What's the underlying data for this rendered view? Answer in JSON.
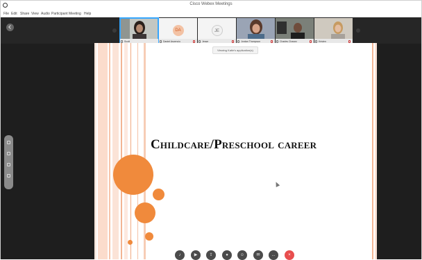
{
  "window": {
    "title": "Cisco Webex Meetings"
  },
  "menu": [
    "File",
    "Edit",
    "Share",
    "View",
    "Audio",
    "Participant",
    "Meeting",
    "Help"
  ],
  "participants": [
    {
      "name": "Scott",
      "type": "video",
      "active": true
    },
    {
      "name": "Daniel Ascencio",
      "type": "initials",
      "initials": "DA",
      "color": "#f3c2a4",
      "text_color": "#d05a22"
    },
    {
      "name": "Jesse",
      "type": "initials",
      "initials": "JE",
      "color": "#f1f1f1",
      "text_color": "#6e6e6e"
    },
    {
      "name": "Jordan Thompson",
      "type": "video"
    },
    {
      "name": "Charles Chavez",
      "type": "video"
    },
    {
      "name": "Kristen",
      "type": "video"
    }
  ],
  "share": {
    "viewing_label": "Viewing Katie's application(s)"
  },
  "slide": {
    "title": "Childcare/Preschool career",
    "accent_color": "#f08a3c"
  },
  "controls": [
    {
      "name": "mute",
      "icon": "microphone-icon"
    },
    {
      "name": "video",
      "icon": "camera-icon"
    },
    {
      "name": "share",
      "icon": "share-icon"
    },
    {
      "name": "record",
      "icon": "record-icon"
    },
    {
      "name": "participants",
      "icon": "person-icon"
    },
    {
      "name": "chat",
      "icon": "chat-icon"
    },
    {
      "name": "more",
      "icon": "more-icon",
      "label": "..."
    },
    {
      "name": "end",
      "icon": "close-icon",
      "label": "×"
    }
  ]
}
